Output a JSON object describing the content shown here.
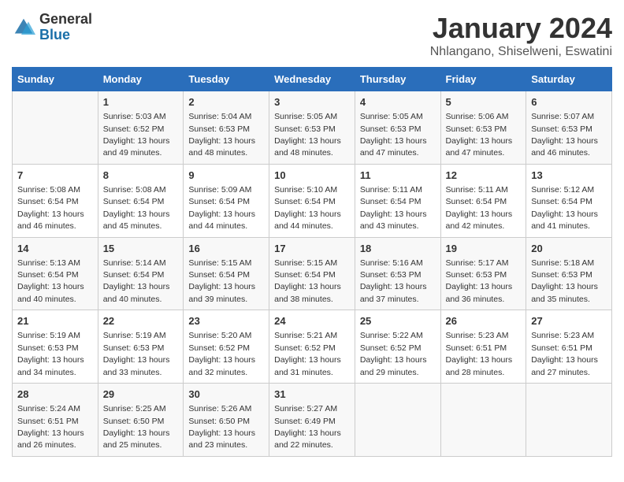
{
  "logo": {
    "general": "General",
    "blue": "Blue"
  },
  "title": "January 2024",
  "subtitle": "Nhlangano, Shiselweni, Eswatini",
  "days": [
    "Sunday",
    "Monday",
    "Tuesday",
    "Wednesday",
    "Thursday",
    "Friday",
    "Saturday"
  ],
  "weeks": [
    [
      {
        "num": "",
        "text": ""
      },
      {
        "num": "1",
        "text": "Sunrise: 5:03 AM\nSunset: 6:52 PM\nDaylight: 13 hours\nand 49 minutes."
      },
      {
        "num": "2",
        "text": "Sunrise: 5:04 AM\nSunset: 6:53 PM\nDaylight: 13 hours\nand 48 minutes."
      },
      {
        "num": "3",
        "text": "Sunrise: 5:05 AM\nSunset: 6:53 PM\nDaylight: 13 hours\nand 48 minutes."
      },
      {
        "num": "4",
        "text": "Sunrise: 5:05 AM\nSunset: 6:53 PM\nDaylight: 13 hours\nand 47 minutes."
      },
      {
        "num": "5",
        "text": "Sunrise: 5:06 AM\nSunset: 6:53 PM\nDaylight: 13 hours\nand 47 minutes."
      },
      {
        "num": "6",
        "text": "Sunrise: 5:07 AM\nSunset: 6:53 PM\nDaylight: 13 hours\nand 46 minutes."
      }
    ],
    [
      {
        "num": "7",
        "text": "Sunrise: 5:08 AM\nSunset: 6:54 PM\nDaylight: 13 hours\nand 46 minutes."
      },
      {
        "num": "8",
        "text": "Sunrise: 5:08 AM\nSunset: 6:54 PM\nDaylight: 13 hours\nand 45 minutes."
      },
      {
        "num": "9",
        "text": "Sunrise: 5:09 AM\nSunset: 6:54 PM\nDaylight: 13 hours\nand 44 minutes."
      },
      {
        "num": "10",
        "text": "Sunrise: 5:10 AM\nSunset: 6:54 PM\nDaylight: 13 hours\nand 44 minutes."
      },
      {
        "num": "11",
        "text": "Sunrise: 5:11 AM\nSunset: 6:54 PM\nDaylight: 13 hours\nand 43 minutes."
      },
      {
        "num": "12",
        "text": "Sunrise: 5:11 AM\nSunset: 6:54 PM\nDaylight: 13 hours\nand 42 minutes."
      },
      {
        "num": "13",
        "text": "Sunrise: 5:12 AM\nSunset: 6:54 PM\nDaylight: 13 hours\nand 41 minutes."
      }
    ],
    [
      {
        "num": "14",
        "text": "Sunrise: 5:13 AM\nSunset: 6:54 PM\nDaylight: 13 hours\nand 40 minutes."
      },
      {
        "num": "15",
        "text": "Sunrise: 5:14 AM\nSunset: 6:54 PM\nDaylight: 13 hours\nand 40 minutes."
      },
      {
        "num": "16",
        "text": "Sunrise: 5:15 AM\nSunset: 6:54 PM\nDaylight: 13 hours\nand 39 minutes."
      },
      {
        "num": "17",
        "text": "Sunrise: 5:15 AM\nSunset: 6:54 PM\nDaylight: 13 hours\nand 38 minutes."
      },
      {
        "num": "18",
        "text": "Sunrise: 5:16 AM\nSunset: 6:53 PM\nDaylight: 13 hours\nand 37 minutes."
      },
      {
        "num": "19",
        "text": "Sunrise: 5:17 AM\nSunset: 6:53 PM\nDaylight: 13 hours\nand 36 minutes."
      },
      {
        "num": "20",
        "text": "Sunrise: 5:18 AM\nSunset: 6:53 PM\nDaylight: 13 hours\nand 35 minutes."
      }
    ],
    [
      {
        "num": "21",
        "text": "Sunrise: 5:19 AM\nSunset: 6:53 PM\nDaylight: 13 hours\nand 34 minutes."
      },
      {
        "num": "22",
        "text": "Sunrise: 5:19 AM\nSunset: 6:53 PM\nDaylight: 13 hours\nand 33 minutes."
      },
      {
        "num": "23",
        "text": "Sunrise: 5:20 AM\nSunset: 6:52 PM\nDaylight: 13 hours\nand 32 minutes."
      },
      {
        "num": "24",
        "text": "Sunrise: 5:21 AM\nSunset: 6:52 PM\nDaylight: 13 hours\nand 31 minutes."
      },
      {
        "num": "25",
        "text": "Sunrise: 5:22 AM\nSunset: 6:52 PM\nDaylight: 13 hours\nand 29 minutes."
      },
      {
        "num": "26",
        "text": "Sunrise: 5:23 AM\nSunset: 6:51 PM\nDaylight: 13 hours\nand 28 minutes."
      },
      {
        "num": "27",
        "text": "Sunrise: 5:23 AM\nSunset: 6:51 PM\nDaylight: 13 hours\nand 27 minutes."
      }
    ],
    [
      {
        "num": "28",
        "text": "Sunrise: 5:24 AM\nSunset: 6:51 PM\nDaylight: 13 hours\nand 26 minutes."
      },
      {
        "num": "29",
        "text": "Sunrise: 5:25 AM\nSunset: 6:50 PM\nDaylight: 13 hours\nand 25 minutes."
      },
      {
        "num": "30",
        "text": "Sunrise: 5:26 AM\nSunset: 6:50 PM\nDaylight: 13 hours\nand 23 minutes."
      },
      {
        "num": "31",
        "text": "Sunrise: 5:27 AM\nSunset: 6:49 PM\nDaylight: 13 hours\nand 22 minutes."
      },
      {
        "num": "",
        "text": ""
      },
      {
        "num": "",
        "text": ""
      },
      {
        "num": "",
        "text": ""
      }
    ]
  ]
}
